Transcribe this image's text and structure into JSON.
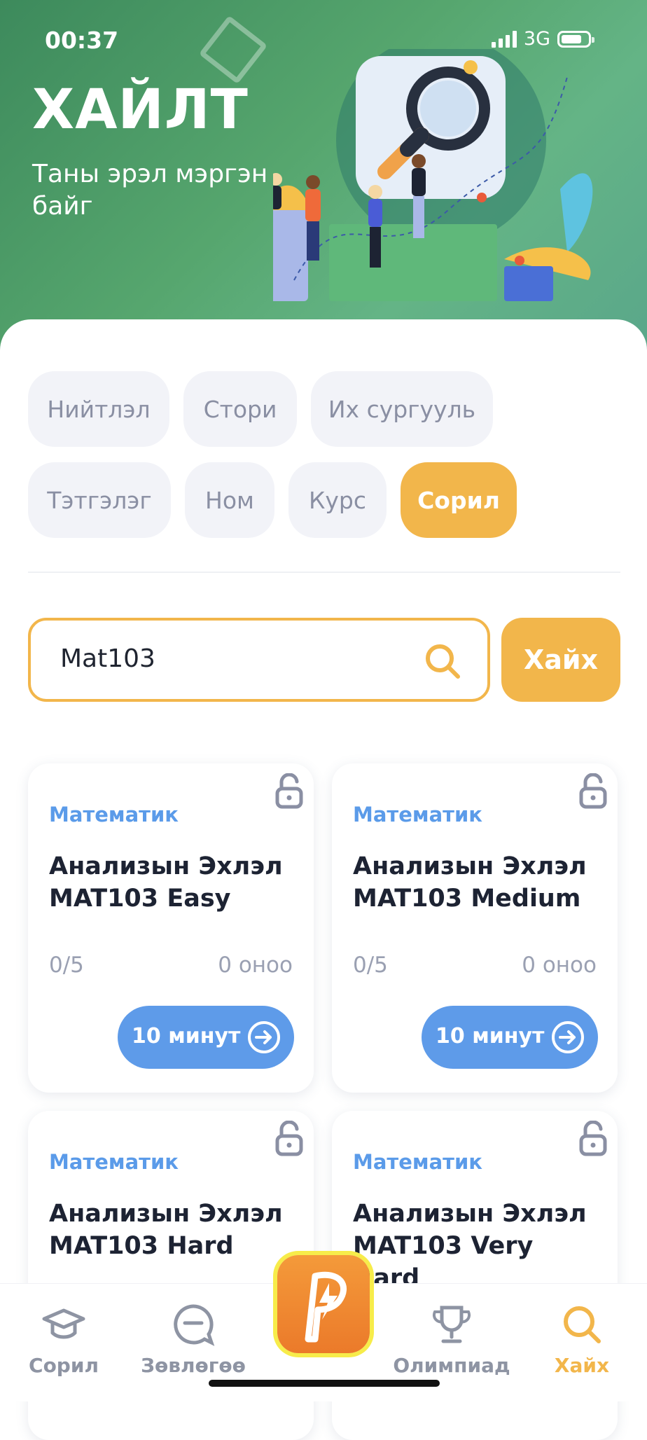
{
  "status": {
    "time": "00:37",
    "network": "3G"
  },
  "header": {
    "title": "ХАЙЛТ",
    "subtitle": "Таны эрэл мэргэн байг"
  },
  "filters": [
    {
      "label": "Нийтлэл",
      "active": false
    },
    {
      "label": "Стори",
      "active": false
    },
    {
      "label": "Их сургууль",
      "active": false
    },
    {
      "label": "Тэтгэлэг",
      "active": false
    },
    {
      "label": "Ном",
      "active": false
    },
    {
      "label": "Курс",
      "active": false
    },
    {
      "label": "Сорил",
      "active": true
    }
  ],
  "search": {
    "value": "Mat103",
    "button_label": "Хайх"
  },
  "results": [
    {
      "subject": "Математик",
      "name": "Анализын Эхлэл MAT103 Easy",
      "progress": "0/5",
      "score": "0 оноо",
      "duration": "10 минут"
    },
    {
      "subject": "Математик",
      "name": "Анализын Эхлэл MAT103 Medium",
      "progress": "0/5",
      "score": "0 оноо",
      "duration": "10 минут"
    },
    {
      "subject": "Математик",
      "name": "Анализын Эхлэл MAT103 Hard",
      "progress": "",
      "score": "",
      "duration": ""
    },
    {
      "subject": "Математик",
      "name": "Анализын Эхлэл MAT103 Very Hard",
      "progress": "",
      "score": "",
      "duration": ""
    }
  ],
  "tabbar": {
    "items": [
      {
        "label": "Сорил",
        "icon": "graduation-cap-icon",
        "active": false
      },
      {
        "label": "Зөвлөгөө",
        "icon": "chat-bubble-icon",
        "active": false
      },
      {
        "label": "",
        "icon": "lightning-p-logo-icon",
        "active": false
      },
      {
        "label": "Олимпиад",
        "icon": "trophy-icon",
        "active": false
      },
      {
        "label": "Хайх",
        "icon": "search-icon",
        "active": true
      }
    ]
  },
  "colors": {
    "accent": "#f2b64b",
    "blue": "#5e9be9",
    "hero_green": "#56a66e"
  }
}
